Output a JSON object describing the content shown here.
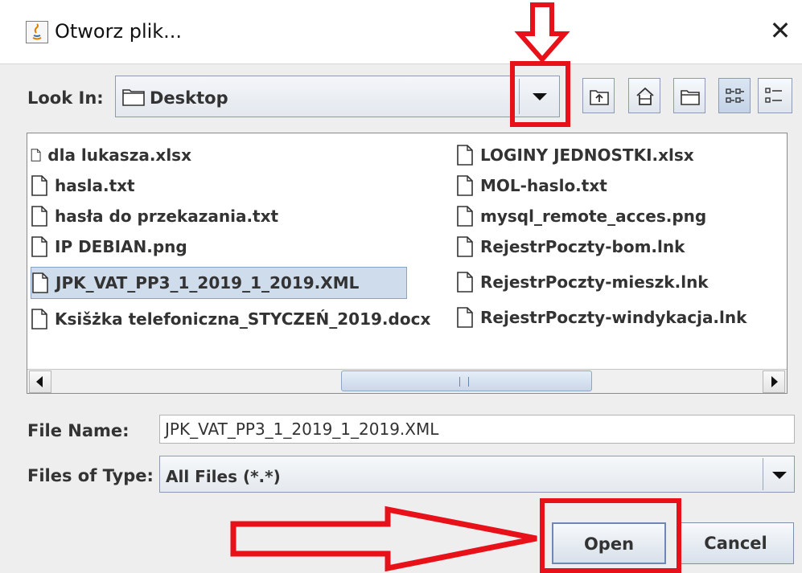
{
  "window": {
    "title": "Otworz plik...",
    "close_label": "✕"
  },
  "look_in": {
    "label": "Look In:",
    "value": "Desktop"
  },
  "toolbar": [
    "up-one-level",
    "home",
    "new-folder",
    "list-view",
    "details-view"
  ],
  "files_left": [
    {
      "name": "dla lukasza.xlsx",
      "selected": false
    },
    {
      "name": "hasla.txt",
      "selected": false
    },
    {
      "name": "hasła do przekazania.txt",
      "selected": false
    },
    {
      "name": "IP DEBIAN.png",
      "selected": false
    },
    {
      "name": "JPK_VAT_PP3_1_2019_1_2019.XML",
      "selected": true
    },
    {
      "name": "Ksišżka telefoniczna_STYCZEŃ_2019.docx",
      "selected": false
    }
  ],
  "files_right": [
    {
      "name": "LOGINY JEDNOSTKI.xlsx",
      "selected": false
    },
    {
      "name": "MOL-haslo.txt",
      "selected": false
    },
    {
      "name": "mysql_remote_acces.png",
      "selected": false
    },
    {
      "name": "RejestrPoczty-bom.lnk",
      "selected": false
    },
    {
      "name": "RejestrPoczty-mieszk.lnk",
      "selected": false
    },
    {
      "name": "RejestrPoczty-windykacja.lnk",
      "selected": false
    }
  ],
  "file_name": {
    "label": "File Name:",
    "value": "JPK_VAT_PP3_1_2019_1_2019.XML"
  },
  "file_type": {
    "label": "Files of Type:",
    "value": "All Files (*.*)"
  },
  "buttons": {
    "open": "Open",
    "cancel": "Cancel"
  },
  "colors": {
    "annotation": "#e8111a",
    "selection": "#cfdcec"
  }
}
